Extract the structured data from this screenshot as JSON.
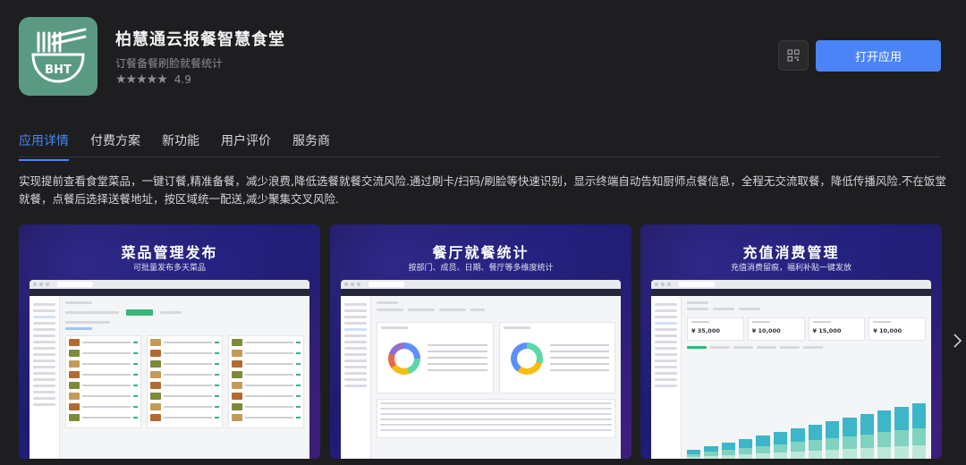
{
  "app": {
    "title": "柏慧通云报餐智慧食堂",
    "subtitle": "订餐备餐刷脸就餐统计",
    "rating": "4.9",
    "stars": "★★★★★",
    "icon_name": "canteen-bowl-icon",
    "icon_text": "BHT"
  },
  "actions": {
    "qr_icon": "qr-code-icon",
    "open_label": "打开应用"
  },
  "tabs": [
    {
      "label": "应用详情",
      "active": true
    },
    {
      "label": "付费方案",
      "active": false
    },
    {
      "label": "新功能",
      "active": false
    },
    {
      "label": "用户评价",
      "active": false
    },
    {
      "label": "服务商",
      "active": false
    }
  ],
  "description": "实现提前查看食堂菜品，一键订餐,精准备餐，减少浪费,降低选餐就餐交流风险.通过刷卡/扫码/刷脸等快速识别，显示终端自动告知厨师点餐信息，全程无交流取餐，降低传播风险.不在饭堂就餐，点餐后选择送餐地址，按区域统一配送,减少聚集交叉风险.",
  "screenshots": [
    {
      "title": "菜品管理发布",
      "subtitle": "可批量发布多天菜品"
    },
    {
      "title": "餐厅就餐统计",
      "subtitle": "按部门、成员、日期、餐厅等多维度统计"
    },
    {
      "title": "充值消费管理",
      "subtitle": "充值消费留痕，福利补贴一键发放",
      "stats": [
        "¥ 35,000",
        "¥ 10,000",
        "¥ 15,000",
        "¥ 10,000"
      ]
    }
  ],
  "colors": {
    "accent": "#4b84f6",
    "icon_bg": "#5a9a82"
  }
}
